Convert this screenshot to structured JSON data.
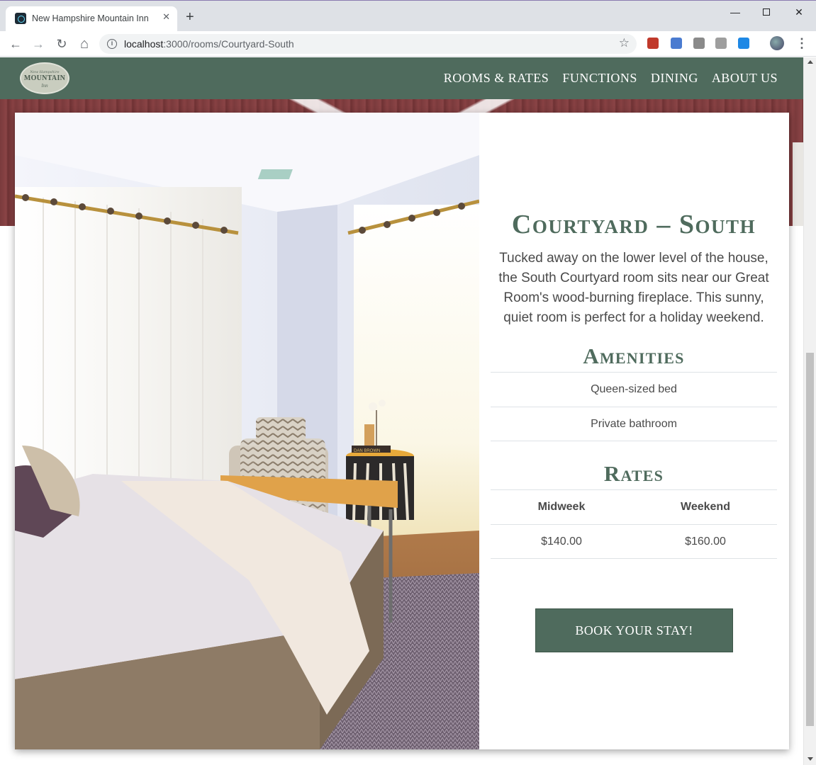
{
  "browser": {
    "tab_title": "New Hampshire Mountain Inn",
    "tab_close": "✕",
    "new_tab": "+",
    "url_host": "localhost",
    "url_path": ":3000/rooms/Courtyard-South",
    "window_controls": {
      "minimize": "—",
      "close": "✕"
    },
    "nav": {
      "back": "←",
      "forward": "→",
      "reload": "↻",
      "home": "⌂"
    },
    "bookmark_star": "☆",
    "menu": "⋮",
    "extension_icons": [
      "lastpass-icon",
      "extension-icon",
      "edit-extension-icon",
      "image-extension-icon",
      "refresh-extension-icon"
    ],
    "extension_colors": [
      "#c0392b",
      "#4a7bd0",
      "#8a8a8a",
      "#9e9e9e",
      "#1e88e5"
    ]
  },
  "site": {
    "logo": {
      "top": "New Hampshire",
      "main": "MOUNTAIN",
      "sub": "Inn"
    },
    "nav": [
      "ROOMS & RATES",
      "FUNCTIONS",
      "DINING",
      "ABOUT US"
    ]
  },
  "room": {
    "title": "Courtyard – South",
    "description": "Tucked away on the lower level of the house, the South Courtyard room sits near our Great Room's wood-burning fireplace. This sunny, quiet room is perfect for a holiday weekend.",
    "amenities_title": "Amenities",
    "amenities": [
      "Queen-sized bed",
      "Private bathroom"
    ],
    "rates_title": "Rates",
    "rates_headers": [
      "Midweek",
      "Weekend"
    ],
    "rates_values": [
      "$140.00",
      "$160.00"
    ],
    "book_label": "BOOK YOUR STAY!",
    "photo_book_spine": "DAN BROWN"
  },
  "colors": {
    "brand_green": "#4f6b5d",
    "text": "#4a4a4a",
    "border": "#dee2e6"
  }
}
